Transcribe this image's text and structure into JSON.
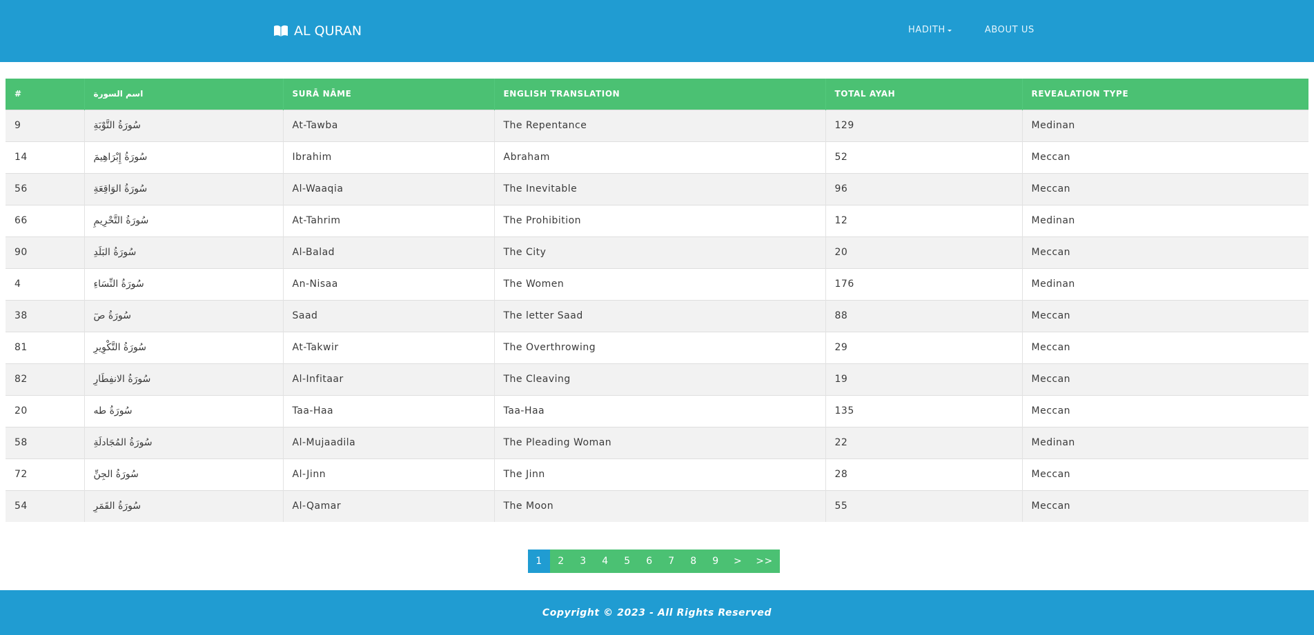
{
  "navbar": {
    "brand_label": "AL QURAN",
    "brand_icon": "open-book-icon",
    "links": [
      {
        "label": "HADITH",
        "has_dropdown": true
      },
      {
        "label": "ABOUT US",
        "has_dropdown": false
      }
    ],
    "color": "#209cd2"
  },
  "table": {
    "header_color": "#4bc173",
    "columns": [
      "#",
      "اسم السورة",
      "SURĀ NĀME",
      "ENGLISH TRANSLATION",
      "TOTAL AYAH",
      "REVEALATION TYPE"
    ],
    "rows": [
      [
        "9",
        "سُورَةُ التَّوْبَةِ",
        "At-Tawba",
        "The Repentance",
        "129",
        "Medinan"
      ],
      [
        "14",
        "سُورَةُ إِبْرَاهِيمَ",
        "Ibrahim",
        "Abraham",
        "52",
        "Meccan"
      ],
      [
        "56",
        "سُورَةُ الوَاقِعَةِ",
        "Al-Waaqia",
        "The Inevitable",
        "96",
        "Meccan"
      ],
      [
        "66",
        "سُورَةُ التَّحْرِيمِ",
        "At-Tahrim",
        "The Prohibition",
        "12",
        "Medinan"
      ],
      [
        "90",
        "سُورَةُ البَلَدِ",
        "Al-Balad",
        "The City",
        "20",
        "Meccan"
      ],
      [
        "4",
        "سُورَةُ النِّسَاءِ",
        "An-Nisaa",
        "The Women",
        "176",
        "Medinan"
      ],
      [
        "38",
        "سُورَةُ صٓ",
        "Saad",
        "The letter Saad",
        "88",
        "Meccan"
      ],
      [
        "81",
        "سُورَةُ التَّكْوِيرِ",
        "At-Takwir",
        "The Overthrowing",
        "29",
        "Meccan"
      ],
      [
        "82",
        "سُورَةُ الانفِطَارِ",
        "Al-Infitaar",
        "The Cleaving",
        "19",
        "Meccan"
      ],
      [
        "20",
        "سُورَةُ طه",
        "Taa-Haa",
        "Taa-Haa",
        "135",
        "Meccan"
      ],
      [
        "58",
        "سُورَةُ المُجَادلَةِ",
        "Al-Mujaadila",
        "The Pleading Woman",
        "22",
        "Medinan"
      ],
      [
        "72",
        "سُورَةُ الجِنِّ",
        "Al-Jinn",
        "The Jinn",
        "28",
        "Meccan"
      ],
      [
        "54",
        "سُورَةُ القَمَرِ",
        "Al-Qamar",
        "The Moon",
        "55",
        "Meccan"
      ]
    ]
  },
  "pagination": {
    "active_page": "1",
    "items": [
      "1",
      "2",
      "3",
      "4",
      "5",
      "6",
      "7",
      "8",
      "9",
      ">",
      ">>"
    ],
    "active_color": "#209cd2",
    "color": "#4bc173"
  },
  "footer": {
    "text": "Copyright © 2023 - All Rights Reserved"
  }
}
